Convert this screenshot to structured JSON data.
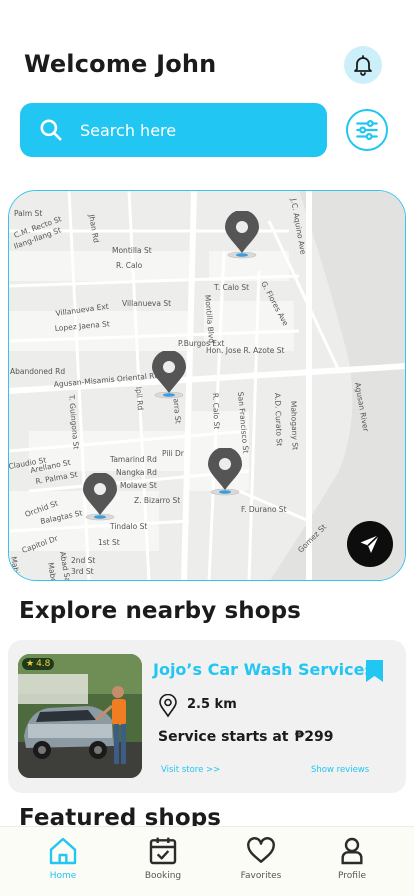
{
  "header": {
    "title": "Welcome John",
    "bell_icon": "bell-icon"
  },
  "search": {
    "placeholder": "Search here",
    "value": "",
    "search_icon": "search-icon",
    "filter_icon": "sliders-icon"
  },
  "map": {
    "street_labels": [
      "Palm St",
      "Jhan Rd",
      "C.M. Recto St",
      "Ilang-Ilang St",
      "Montilla St",
      "R. Calo",
      "T. Calo St",
      "Villanueva Ext",
      "Villanueva St",
      "Lopez Jaena St",
      "P.Burgos Ext",
      "Hon. Jose R. Azote St",
      "Abandoned Rd",
      "Agusan-Misamis Oriental Rd",
      "Montilla Blvd.",
      "G. Flores Ave",
      "J.C. Aquino Ave",
      "Agusan River",
      "Pili Dr",
      "T. Guingona St",
      "Tamarind Rd",
      "Nangka Rd",
      "Molave St",
      "Z. Bizarro St",
      "Tindalo St",
      "Mabolo St",
      "Balagtas St",
      "Orchid St",
      "Capitol Dr",
      "1st St",
      "2nd St",
      "3rd St",
      "F. Durano St",
      "San Francisco St",
      "A.D. Curato St",
      "R. Calo St",
      "Mahogany St",
      "Narra St",
      "Ipil Rd",
      "Arellano St",
      "Claudio St",
      "R. Palma St",
      "Mabini St",
      "Abad Santos St",
      "Gomez St"
    ],
    "send_icon": "send-icon",
    "pin_icon": "location-pin-icon"
  },
  "explore": {
    "title": "Explore nearby shops"
  },
  "shop": {
    "name": "Jojo’s Car Wash Services",
    "rating": "4.8",
    "distance": "2.5 km",
    "price_label": "Service starts at",
    "price": "₱299",
    "visit_link": "Visit store >>",
    "reviews_link": "Show reviews",
    "bookmark_icon": "bookmark-icon",
    "location_icon": "location-pin-icon",
    "accent": "#22c6f2"
  },
  "featured": {
    "title": "Featured shops"
  },
  "nav": {
    "items": [
      {
        "label": "Home",
        "icon": "home-icon",
        "active": true
      },
      {
        "label": "Booking",
        "icon": "calendar-icon",
        "active": false
      },
      {
        "label": "Favorites",
        "icon": "heart-icon",
        "active": false
      },
      {
        "label": "Profile",
        "icon": "user-icon",
        "active": false
      }
    ]
  }
}
